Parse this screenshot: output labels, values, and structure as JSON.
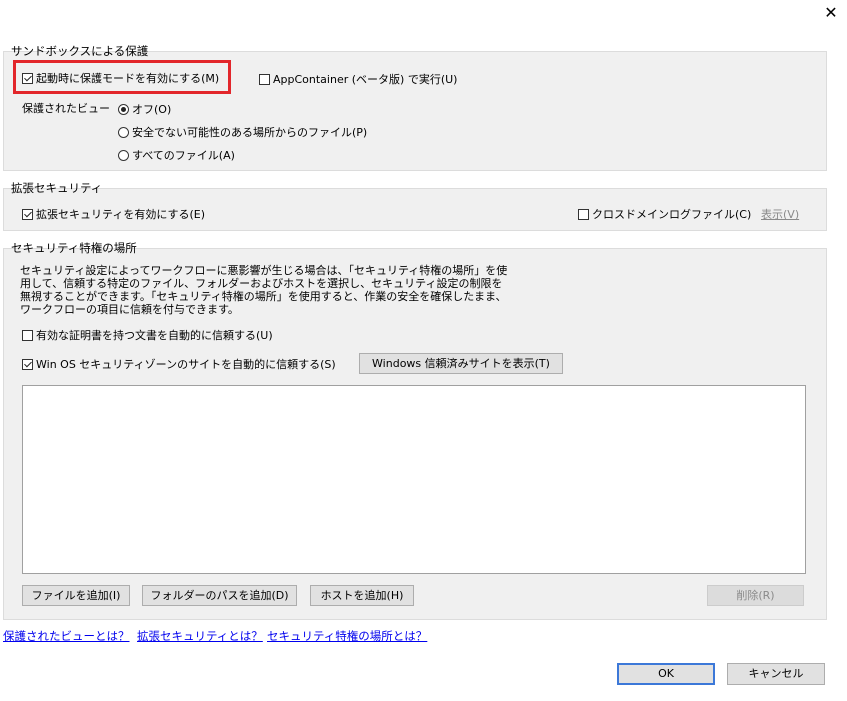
{
  "dialog": {
    "close_glyph": "✕"
  },
  "sandbox": {
    "title": "サンドボックスによる保護",
    "enable_protected_mode": {
      "label": "起動時に保護モードを有効にする(M)",
      "checked": true
    },
    "appcontainer": {
      "label": "AppContainer (ベータ版) で実行(U)",
      "checked": false
    },
    "protected_view_label": "保護されたビュー",
    "radios": [
      {
        "label": "オフ(O)",
        "selected": true
      },
      {
        "label": "安全でない可能性のある場所からのファイル(P)",
        "selected": false
      },
      {
        "label": "すべてのファイル(A)",
        "selected": false
      }
    ]
  },
  "enhanced": {
    "title": "拡張セキュリティ",
    "enable": {
      "label": "拡張セキュリティを有効にする(E)",
      "checked": true
    },
    "cross_domain": {
      "label": "クロスドメインログファイル(C)",
      "checked": false
    },
    "view_label": "表示(V)"
  },
  "privileged": {
    "title": "セキュリティ特権の場所",
    "description": "セキュリティ設定によってワークフローに悪影響が生じる場合は、「セキュリティ特権の場所」を使用して、信頼する特定のファイル、フォルダーおよびホストを選択し、セキュリティ設定の制限を無視することができます。「セキュリティ特権の場所」を使用すると、作業の安全を確保したまま、ワークフローの項目に信頼を付与できます。",
    "trust_certified": {
      "label": "有効な証明書を持つ文書を自動的に信頼する(U)",
      "checked": false
    },
    "trust_win_os": {
      "label": "Win OS セキュリティゾーンのサイトを自動的に信頼する(S)",
      "checked": true
    },
    "show_windows_sites_button": "Windows 信頼済みサイトを表示(T)",
    "add_file_button": "ファイルを追加(I)",
    "add_folder_button": "フォルダーのパスを追加(D)",
    "add_host_button": "ホストを追加(H)",
    "remove_button": "削除(R)"
  },
  "links": {
    "protected_view": "保護されたビューとは？",
    "enhanced_security": "拡張セキュリティとは？",
    "privileged_locations": "セキュリティ特権の場所とは？"
  },
  "footer": {
    "ok_button": "OK",
    "cancel_button": "キャンセル"
  },
  "colors": {
    "highlight_box": "#e2262b",
    "link": "#0000ee",
    "group_bg": "#f0f0f0",
    "default_button_border": "#3c78d8"
  }
}
